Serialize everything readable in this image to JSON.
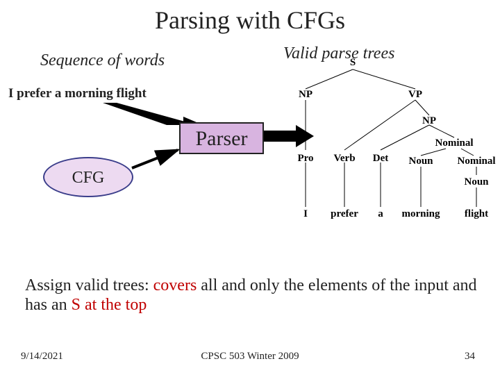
{
  "title": "Parsing with CFGs",
  "sequence_label": "Sequence of words",
  "valid_label": "Valid parse trees",
  "sentence": "I prefer a morning flight",
  "parser_label": "Parser",
  "cfg_label": "CFG",
  "body_prefix": "Assign valid trees: ",
  "body_red1": "covers",
  "body_mid1": " all and only the elements of the input and has an ",
  "body_red2": "S at the top",
  "tree": {
    "S": "S",
    "NP": "NP",
    "VP": "VP",
    "NP2": "NP",
    "Nominal1": "Nominal",
    "Nominal2": "Nominal",
    "Noun2": "Noun",
    "Pro": "Pro",
    "Verb": "Verb",
    "Det": "Det",
    "Noun": "Noun",
    "leaves": {
      "I": "I",
      "prefer": "prefer",
      "a": "a",
      "morning": "morning",
      "flight": "flight"
    }
  },
  "footer": {
    "date": "9/14/2021",
    "course": "CPSC 503 Winter 2009",
    "page": "34"
  }
}
